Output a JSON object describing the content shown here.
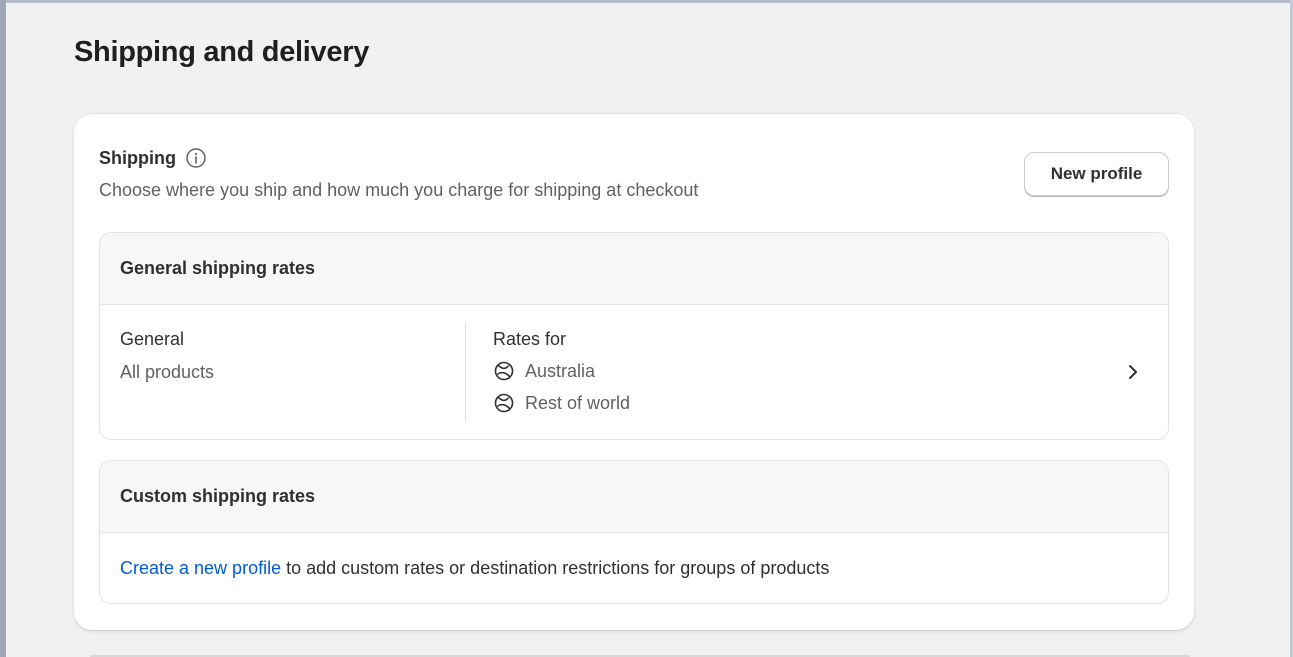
{
  "page": {
    "title": "Shipping and delivery"
  },
  "shipping_card": {
    "title": "Shipping",
    "description": "Choose where you ship and how much you charge for shipping at checkout",
    "new_profile_label": "New profile"
  },
  "general_rates": {
    "heading": "General shipping rates",
    "profile_name": "General",
    "profile_products": "All products",
    "rates_title": "Rates for",
    "zones": [
      {
        "label": "Australia",
        "icon": "globe-icon"
      },
      {
        "label": "Rest of world",
        "icon": "globe-icon"
      }
    ]
  },
  "custom_rates": {
    "heading": "Custom shipping rates",
    "link_text": "Create a new profile",
    "rest_text": " to add custom rates or destination restrictions for groups of products"
  },
  "colors": {
    "link": "#005bd3",
    "background": "#f1f1f1",
    "card": "#ffffff"
  }
}
